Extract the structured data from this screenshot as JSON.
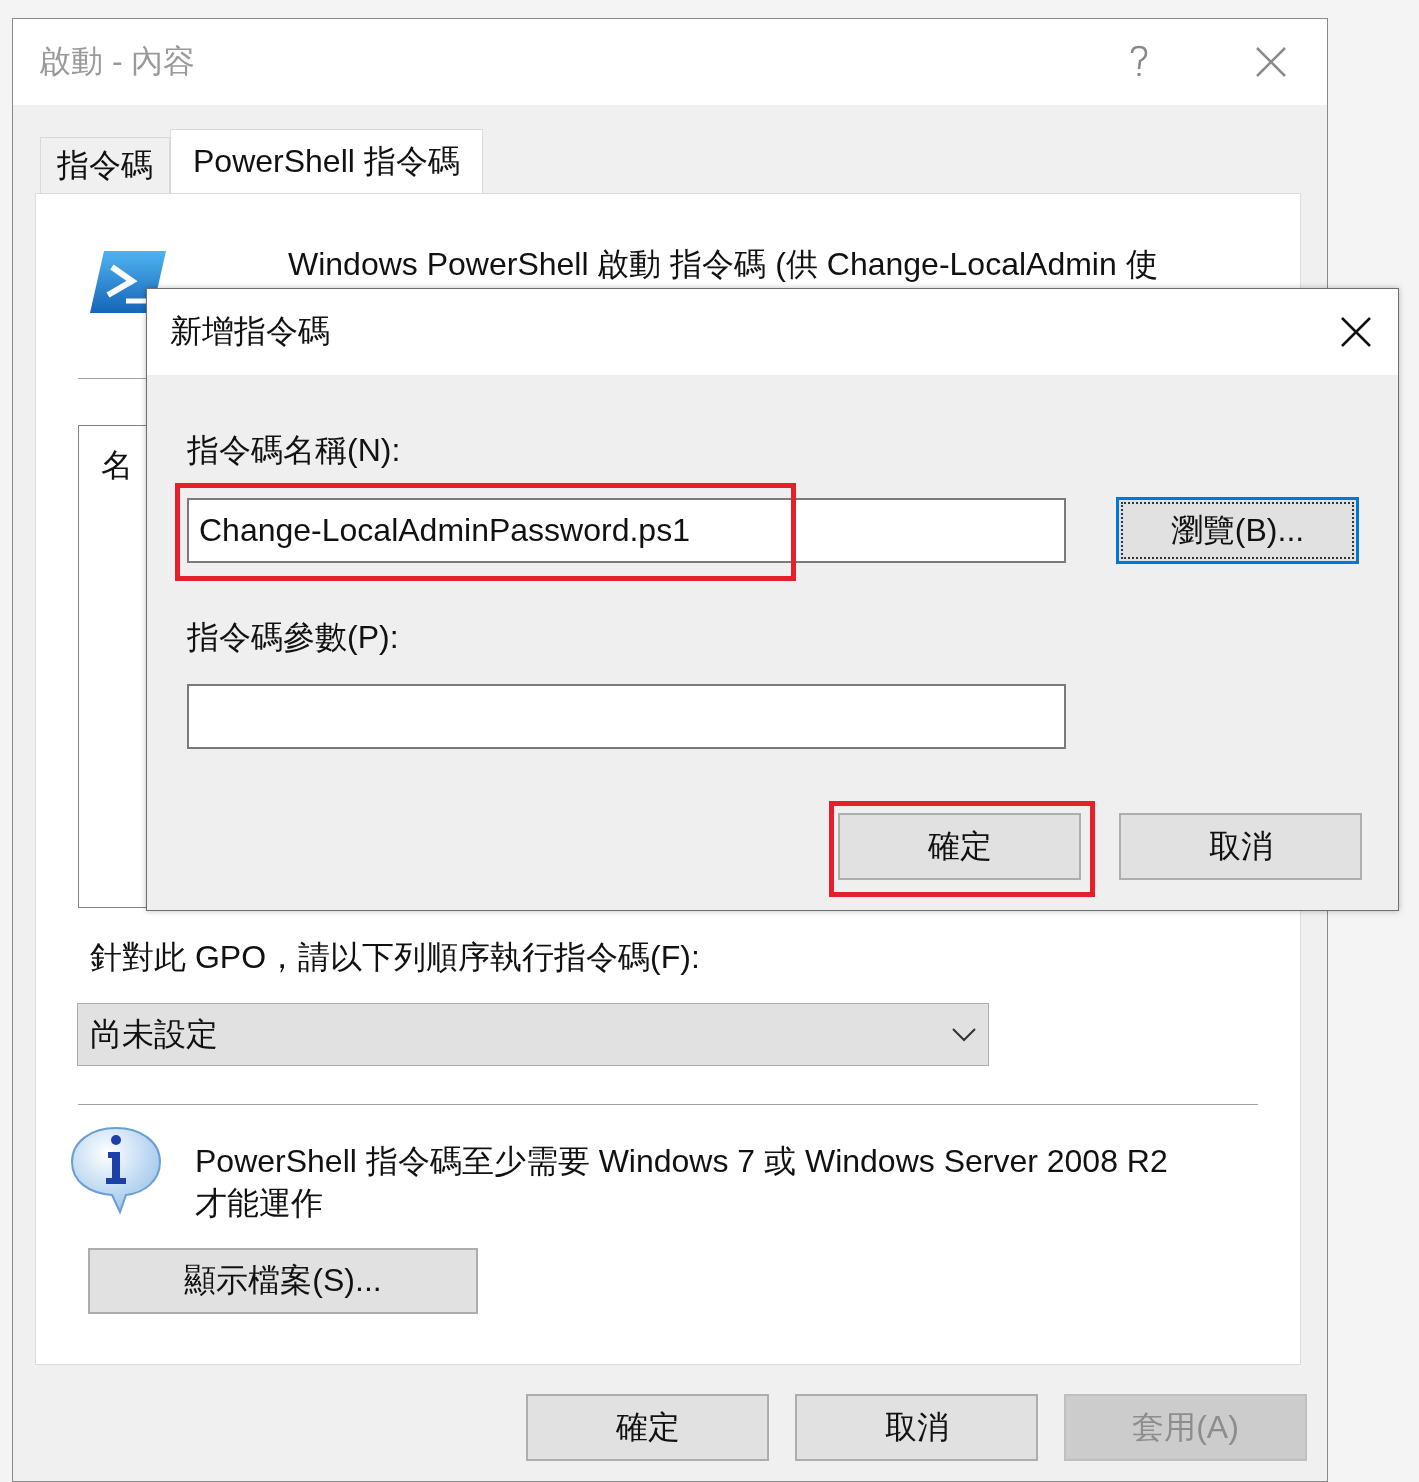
{
  "window": {
    "title": "啟動 - 內容"
  },
  "tabs": [
    {
      "label": "指令碼",
      "selected": false
    },
    {
      "label": "PowerShell 指令碼",
      "selected": true
    }
  ],
  "panel": {
    "heading": "Windows PowerShell 啟動 指令碼 (供 Change-LocalAdmin 使",
    "list": {
      "column_1": "名"
    },
    "order_label": "針對此 GPO，請以下列順序執行指令碼(F):",
    "order_select": {
      "value": "尚未設定"
    },
    "info": "PowerShell 指令碼至少需要 Windows 7 或 Windows Server 2008 R2 才能運作",
    "show_files_button": "顯示檔案(S)..."
  },
  "buttons": [
    {
      "label": "確定",
      "disabled": false
    },
    {
      "label": "取消",
      "disabled": false
    },
    {
      "label": "套用(A)",
      "disabled": true
    }
  ],
  "dialog": {
    "title": "新增指令碼",
    "fields": [
      {
        "label": "指令碼名稱(N):",
        "value": "Change-LocalAdminPassword.ps1",
        "highlighted": true
      },
      {
        "label": "指令碼參數(P):",
        "highlighted": false
      }
    ],
    "browse_button": {
      "label": "瀏覽(B)...",
      "focused": true
    },
    "buttons": [
      {
        "label": "確定",
        "highlighted": true
      },
      {
        "label": "取消",
        "highlighted": false
      }
    ]
  }
}
